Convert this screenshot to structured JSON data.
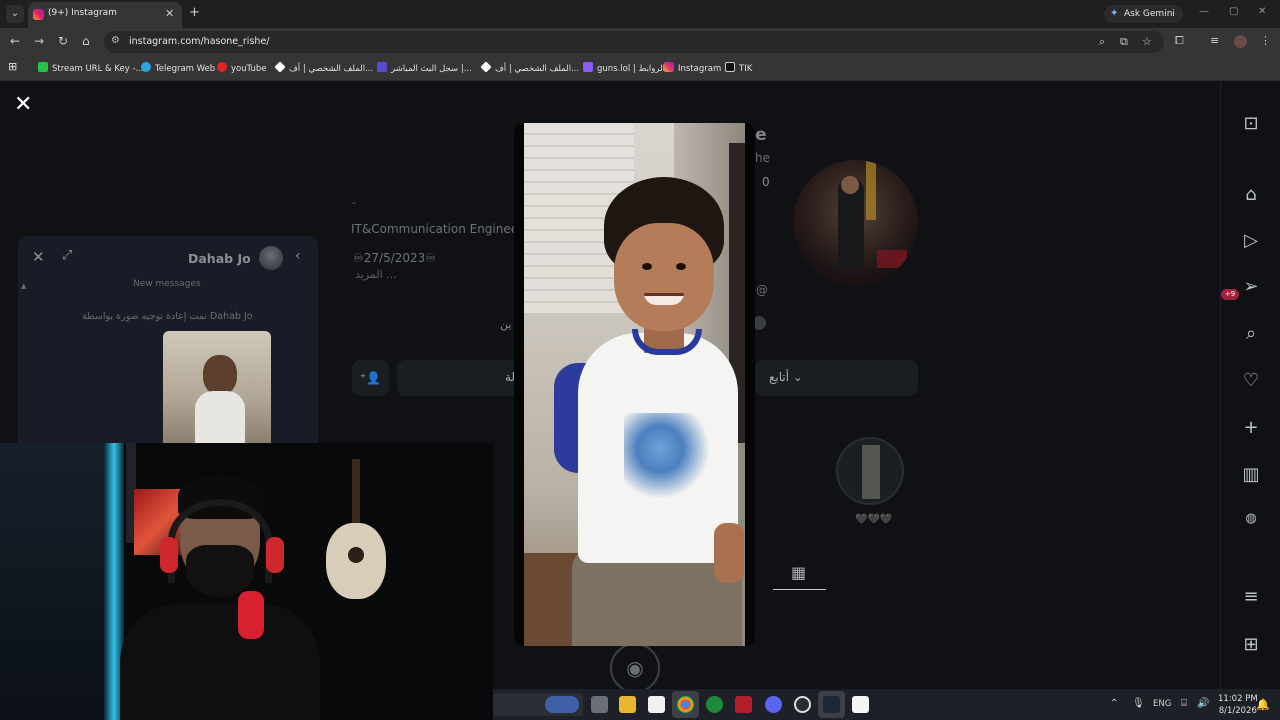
{
  "browser": {
    "tab_title": "(9+) Instagram",
    "ask_gemini": "Ask Gemini",
    "url": "instagram.com/hasone_rishe/",
    "bookmarks": [
      {
        "label": "Stream URL & Key -...",
        "color": "#27c24c"
      },
      {
        "label": "Telegram Web",
        "color": "#2aa3e0"
      },
      {
        "label": "youTube",
        "color": "#e02424"
      },
      {
        "label": "الملف الشخصي | أف...",
        "color": "#ffffff"
      },
      {
        "label": "سجل البث المباشر |...",
        "color": "#5a4bd6"
      },
      {
        "label": "الملف الشخصي | أف...",
        "color": "#ffffff"
      },
      {
        "label": "guns.lol | الروابط",
        "color": "#8a5cf6"
      },
      {
        "label": "Instagram",
        "color": "#e1306c"
      },
      {
        "label": "TIK",
        "color": "#111111"
      }
    ]
  },
  "profile": {
    "name_fragment": "he",
    "sub_fragment": "he",
    "count_fragment": "0",
    "bio_dash": "-",
    "bio_line1": "IT&Communication Engineeri",
    "bio_line2": "♾27/5/2023♾",
    "bio_more": "المزيد ...",
    "followed_by_fragment": "ين",
    "follow_label": "أتابع ⌄",
    "message_fragment": "لة",
    "highlight_label": "🖤🖤🖤"
  },
  "chat": {
    "name": "Dahab Jo",
    "new_messages": "New messages",
    "forwarded_note": "تمت إعادة توجيه صورة بواسطة Dahab Jo"
  },
  "notifications": {
    "messages_badge": "+9"
  },
  "taskbar": {
    "lang": "ENG",
    "time": "11:02 PM",
    "date": "8/1/2026"
  },
  "colors": {
    "accent_blue": "#2d3c9c",
    "notification_red": "#a3223b"
  }
}
